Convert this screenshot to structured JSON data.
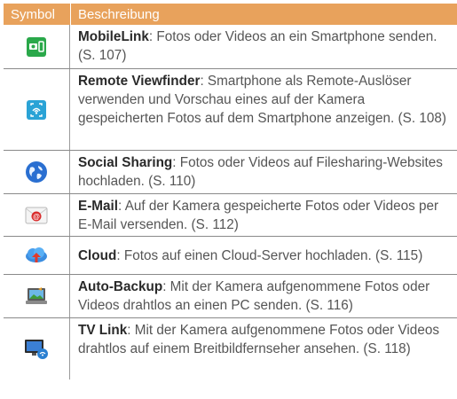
{
  "header": {
    "symbol": "Symbol",
    "description": "Beschreibung"
  },
  "rows": [
    {
      "icon": "mobilelink-icon",
      "term": "MobileLink",
      "text": ": Fotos oder Videos an ein Smartphone senden. (S. 107)"
    },
    {
      "icon": "remote-viewfinder-icon",
      "term": "Remote Viewfinder",
      "text": ": Smartphone als Remote-Auslöser verwenden und Vorschau eines auf der Kamera gespeicherten Fotos auf dem Smartphone anzeigen. (S. 108)"
    },
    {
      "icon": "globe-icon",
      "term": "Social Sharing",
      "text": ": Fotos oder Videos auf Filesharing-Websites hochladen. (S. 110)"
    },
    {
      "icon": "email-icon",
      "term": "E-Mail",
      "text": ": Auf der Kamera gespeicherte Fotos oder Videos per E-Mail versenden. (S. 112)"
    },
    {
      "icon": "cloud-icon",
      "term": "Cloud",
      "text": ": Fotos auf einen Cloud-Server hochladen. (S. 115)"
    },
    {
      "icon": "auto-backup-icon",
      "term": "Auto-Backup",
      "text": ": Mit der Kamera aufgenommene Fotos oder Videos drahtlos an einen PC senden. (S. 116)"
    },
    {
      "icon": "tv-link-icon",
      "term": "TV Link",
      "text": ": Mit der Kamera aufgenommene Fotos oder Videos drahtlos auf einem Breitbildfernseher ansehen. (S. 118)"
    }
  ]
}
